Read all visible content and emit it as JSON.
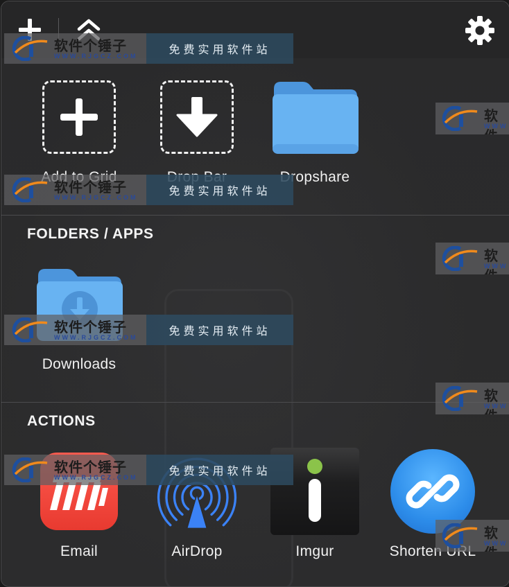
{
  "header": {
    "add_icon": "plus-icon",
    "collapse_icon": "double-chevron-up-icon",
    "settings_icon": "gear-icon"
  },
  "top_items": [
    {
      "label": "Add to Grid",
      "icon": "dashed-plus-icon"
    },
    {
      "label": "Drop Bar",
      "icon": "dashed-down-arrow-icon"
    },
    {
      "label": "Dropshare",
      "icon": "folder-icon"
    }
  ],
  "folders_section": {
    "title": "FOLDERS / APPS",
    "items": [
      {
        "label": "Downloads",
        "icon": "downloads-folder-icon"
      }
    ]
  },
  "actions_section": {
    "title": "ACTIONS",
    "items": [
      {
        "label": "Email",
        "icon": "email-app-icon"
      },
      {
        "label": "AirDrop",
        "icon": "airdrop-icon"
      },
      {
        "label": "Imgur",
        "icon": "imgur-icon"
      },
      {
        "label": "Shorten URL",
        "icon": "link-icon"
      }
    ]
  },
  "watermark": {
    "brand": "软件个锤子",
    "url": "WWW.RJGCZ.COM",
    "slogan": "免费实用软件站",
    "brand_short": "软件",
    "url_short": "WWW"
  },
  "colors": {
    "panel_bg": "#2b2b2c",
    "header_bg": "#262627",
    "folder_blue": "#5aa8ee",
    "email_red": "#ef4136",
    "airdrop_blue": "#3b82f6",
    "imgur_green": "#8bc34a",
    "link_blue": "#2d8dea"
  }
}
